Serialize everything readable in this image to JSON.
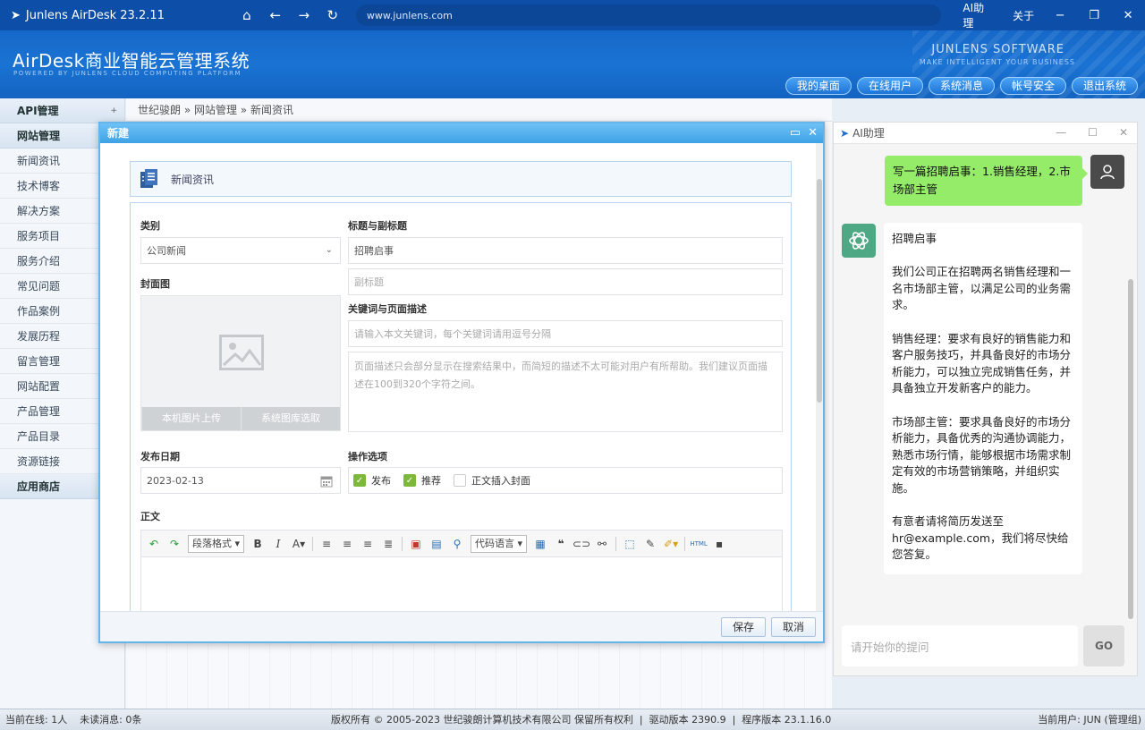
{
  "titlebar": {
    "app_title": "Junlens AirDesk 23.2.11",
    "url": "www.junlens.com",
    "ai_assistant": "AI助理",
    "about": "关于",
    "nav_home": "⌂",
    "nav_back": "←",
    "nav_forward": "→",
    "nav_reload": "↻",
    "win_min": "−",
    "win_max": "❐",
    "win_close": "✕"
  },
  "header": {
    "system_name": "AirDesk商业智能云管理系统",
    "system_sub": "POWERED BY JUNLENS CLOUD COMPUTING PLATFORM",
    "company": "JUNLENS SOFTWARE",
    "company_sub": "MAKE INTELLIGENT YOUR BUSINESS",
    "buttons": [
      "我的桌面",
      "在线用户",
      "系统消息",
      "帐号安全",
      "退出系统"
    ]
  },
  "sidebar": {
    "api_group": "API管理",
    "site_group": "网站管理",
    "items": [
      "新闻资讯",
      "技术博客",
      "解决方案",
      "服务项目",
      "服务介绍",
      "常见问题",
      "作品案例",
      "发展历程",
      "留言管理",
      "网站配置",
      "产品管理",
      "产品目录",
      "资源链接"
    ],
    "app_store": "应用商店"
  },
  "breadcrumb": "世纪骏朗 » 网站管理 » 新闻资讯",
  "modal": {
    "title": "新建",
    "section": "新闻资讯",
    "category_label": "类别",
    "category_value": "公司新闻",
    "title_label": "标题与副标题",
    "title_value": "招聘启事",
    "subtitle_placeholder": "副标题",
    "cover_label": "封面图",
    "upload_local": "本机图片上传",
    "upload_library": "系统图库选取",
    "keywords_label": "关键词与页面描述",
    "keywords_placeholder": "请输入本文关键词，每个关键词请用逗号分隔",
    "desc_placeholder": "页面描述只会部分显示在搜索结果中，而简短的描述不太可能对用户有所帮助。我们建议页面描述在100到320个字符之间。",
    "date_label": "发布日期",
    "date_value": "2023-02-13",
    "options_label": "操作选项",
    "opt_publish": "发布",
    "opt_recommend": "推荐",
    "opt_cover": "正文插入封面",
    "body_label": "正文",
    "toolbar_paragraph": "段落格式",
    "toolbar_code": "代码语言",
    "save": "保存",
    "cancel": "取消"
  },
  "ai_panel": {
    "title": "AI助理",
    "user_message": "写一篇招聘启事：1.销售经理，2.市场部主管",
    "ai_message": "招聘启事\n\n我们公司正在招聘两名销售经理和一名市场部主管，以满足公司的业务需求。\n\n销售经理：要求有良好的销售能力和客户服务技巧，并具备良好的市场分析能力，可以独立完成销售任务，并具备独立开发新客户的能力。\n\n市场部主管：要求具备良好的市场分析能力，具备优秀的沟通协调能力，熟悉市场行情，能够根据市场需求制定有效的市场营销策略，并组织实施。\n\n有意者请将简历发送至hr@example.com，我们将尽快给您答复。",
    "input_placeholder": "请开始你的提问",
    "go": "GO"
  },
  "status": {
    "left": "当前在线: 1人    未读消息: 0条",
    "center": "版权所有 © 2005-2023 世纪骏朗计算机技术有限公司 保留所有权利  |  驱动版本 2390.9  |  程序版本 23.1.16.0",
    "right": "当前用户: JUN (管理组)"
  }
}
